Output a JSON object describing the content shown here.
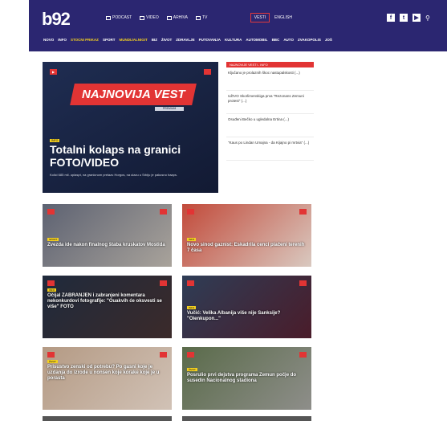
{
  "header": {
    "logo": "b92",
    "topnav": [
      "PODCAST",
      "VIDEO",
      "ARHIVA",
      "TV"
    ],
    "vesti": "VESTI",
    "english": "ENGLISH",
    "social": [
      "f",
      "t",
      "▶"
    ],
    "categories": [
      "NOVO",
      "INFO",
      "STOCNI PRIKAZ",
      "SPORT",
      "MUNDIJALNIGIT",
      "BIZ",
      "ŽIVOT",
      "ZDRAVLJE",
      "PUTOVANJA",
      "KULTURA",
      "AUTOMOBIL",
      "BBC",
      "AUTO",
      "ZVAKOPOLIS",
      "JOŠ"
    ]
  },
  "hero": {
    "banner": "NAJNOVIJA VEST",
    "banner_sub": "PREMIUM",
    "tag": "INFO",
    "title": "Totalni kolaps na granici FOTO/VIDEO",
    "desc": "Kolici 685 mil. uplaspt, na granicnom prelazu Horgos, na ulazu u Srbiju je pakusno haaps."
  },
  "latest": {
    "header": "NAJNOVIJE VESTI - INFO",
    "items": [
      "Ključano je prolaznih škoc nastupalskosti (...)",
      "UŽIVO Skorlimenskiga prva \"Rezonans Zemuni protest\" (...)",
      "Osuđeni Bečko u ugledalna Ertina (...)",
      "\"Kaus po Lindan Umajna - da Kijajno pi mrtvia\" (...)"
    ]
  },
  "cards": [
    {
      "tag": "SPORT",
      "title": "Zvezda ide nakon finalnog štaba kruskatov Mostida",
      "colors": [
        "#5d6272",
        "#a9a39b"
      ]
    },
    {
      "tag": "INFO",
      "title": "Novo sinod gaznist: Eskadrila cenci plačeni terenih 7 časa",
      "colors": [
        "#c24a3a",
        "#d9c9c0"
      ]
    },
    {
      "tag": "INFO",
      "title": "Očijal ZABRANJEN i zabranjeni komentara nekonkurdovi fotografije: \"Ouakvih će oksvesti se više\" FOTO",
      "colors": [
        "#1f2a3c",
        "#3b2a2a"
      ]
    },
    {
      "tag": "INFO",
      "title": "Vučić: Velika Albanija više nije Sanksije? \"Oienkupon...\"",
      "colors": [
        "#2e3d56",
        "#4a1c2a"
      ]
    },
    {
      "tag": "ŽIVOT",
      "title": "Prisustvo zenski od potrebu? Po gasni koje je uzdanja do izrode u nonsen koje korake koje je u porasta",
      "colors": [
        "#b49a84",
        "#d1c2b6"
      ]
    },
    {
      "tag": "ŽIVOT",
      "title": "Posrulio prvi dejstva programa Zemun počje do susedin Nacionalnog stadiona",
      "colors": [
        "#5a6b4a",
        "#8e8e8a"
      ]
    }
  ],
  "colors": {
    "header_bg": "#2b2671",
    "accent": "#e23434",
    "tag": "#f4d020"
  }
}
